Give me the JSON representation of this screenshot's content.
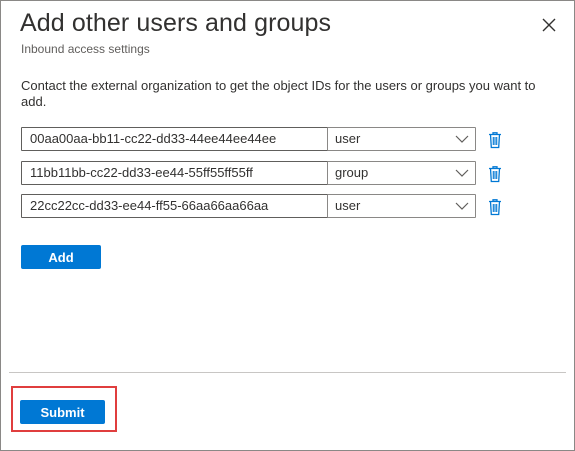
{
  "dialog": {
    "title": "Add other users and groups",
    "subtitle": "Inbound access settings",
    "description": "Contact the external organization to get the object IDs for the users or groups you want to add.",
    "close_icon": "close-icon"
  },
  "entries": [
    {
      "object_id": "00aa00aa-bb11-cc22-dd33-44ee44ee44ee",
      "type": "user"
    },
    {
      "object_id": "11bb11bb-cc22-dd33-ee44-55ff55ff55ff",
      "type": "group"
    },
    {
      "object_id": "22cc22cc-dd33-ee44-ff55-66aa66aa66aa",
      "type": "user"
    }
  ],
  "buttons": {
    "add_label": "Add",
    "submit_label": "Submit"
  },
  "colors": {
    "accent": "#0078d4",
    "highlight": "#e03e3e",
    "trash_icon": "#0078d4"
  }
}
